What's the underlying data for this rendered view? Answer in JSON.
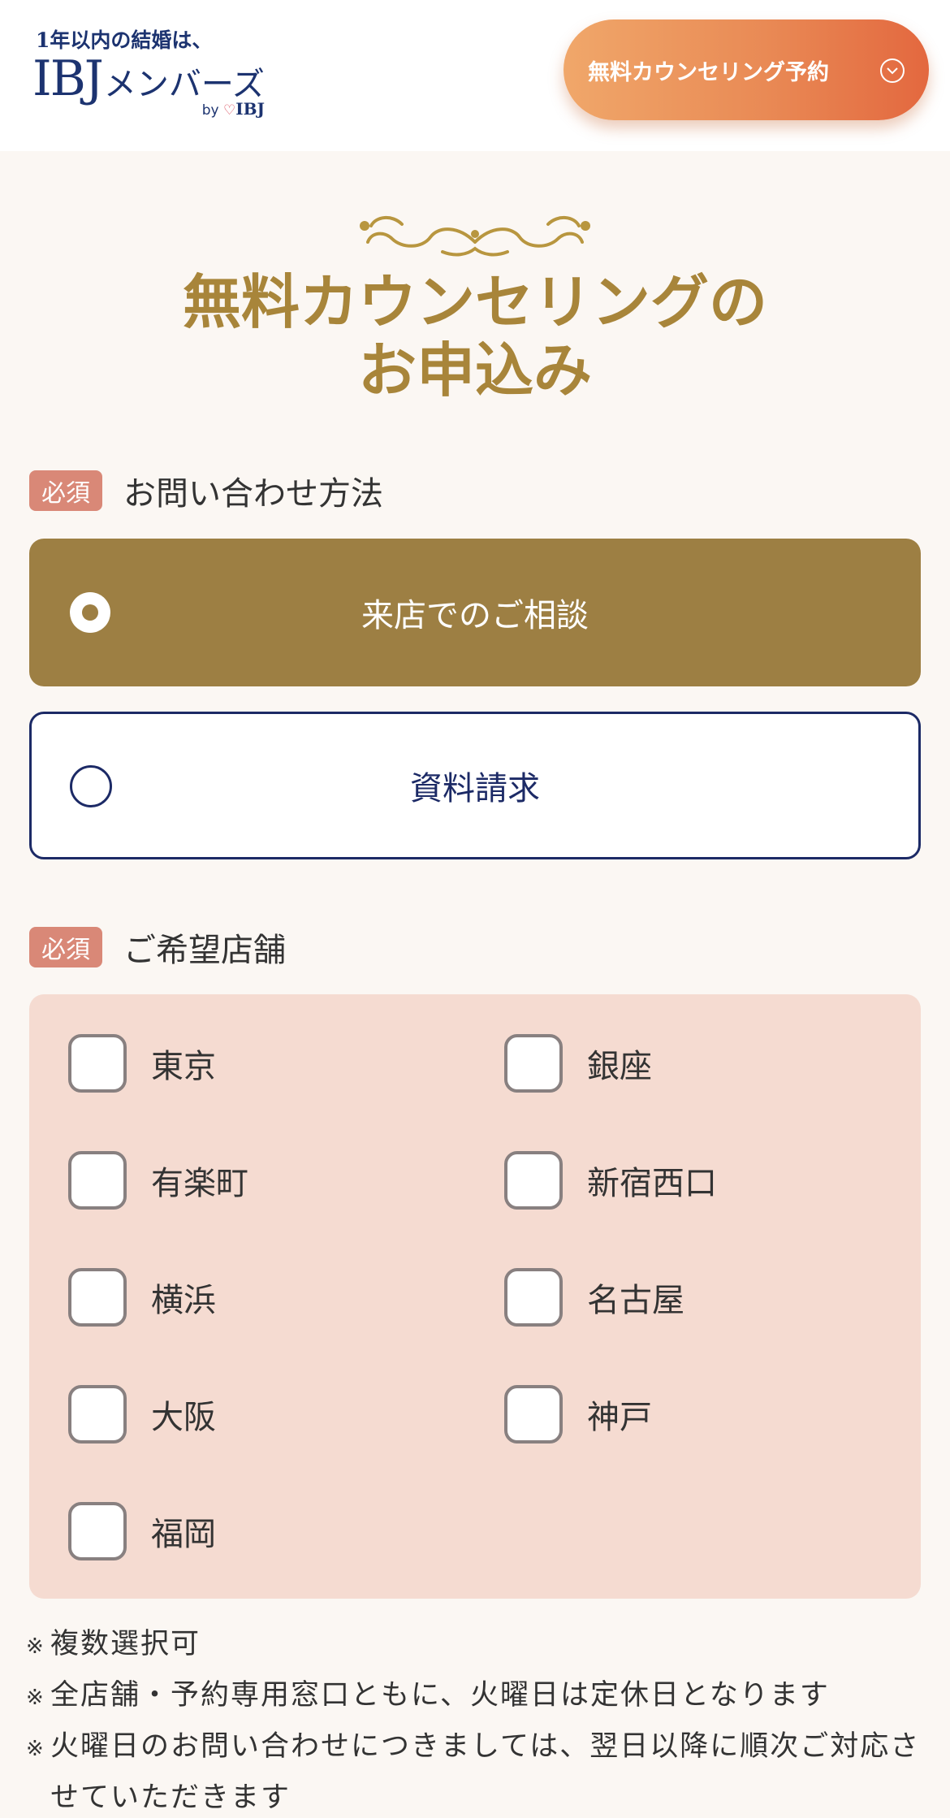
{
  "header": {
    "logo": {
      "tagline": "1年以内の結婚は、",
      "brand_main": "IBJ",
      "brand_sub": "メンバーズ",
      "by_prefix": "by",
      "by_brand": "IBJ"
    },
    "cta_label": "無料カウンセリング予約"
  },
  "page": {
    "title_line1": "無料カウンセリングの",
    "title_line2": "お申込み"
  },
  "contact_method": {
    "required_badge": "必須",
    "label": "お問い合わせ方法",
    "options": [
      {
        "label": "来店でのご相談",
        "selected": true
      },
      {
        "label": "資料請求",
        "selected": false
      }
    ]
  },
  "store": {
    "required_badge": "必須",
    "label": "ご希望店舗",
    "options": [
      {
        "label": "東京",
        "checked": false
      },
      {
        "label": "銀座",
        "checked": false
      },
      {
        "label": "有楽町",
        "checked": false
      },
      {
        "label": "新宿西口",
        "checked": false
      },
      {
        "label": "横浜",
        "checked": false
      },
      {
        "label": "名古屋",
        "checked": false
      },
      {
        "label": "大阪",
        "checked": false
      },
      {
        "label": "神戸",
        "checked": false
      },
      {
        "label": "福岡",
        "checked": false
      }
    ]
  },
  "notes": {
    "mark": "※",
    "items": [
      "複数選択可",
      "全店舗・予約専用窓口ともに、火曜日は定休日となります",
      "火曜日のお問い合わせにつきましては、翌日以降に順次ご対応させていただきます"
    ]
  },
  "colors": {
    "brand_navy": "#1c3370",
    "gold": "#a8853a",
    "selected_bg": "#9d7f43",
    "required_badge": "#d98877",
    "store_box_bg": "#f5dbd1",
    "cta_gradient_start": "#f0a76a",
    "cta_gradient_end": "#e3683f"
  },
  "icons": {
    "cta": "chevron-down-circle-icon",
    "ornament": "flourish-ornament-icon"
  }
}
